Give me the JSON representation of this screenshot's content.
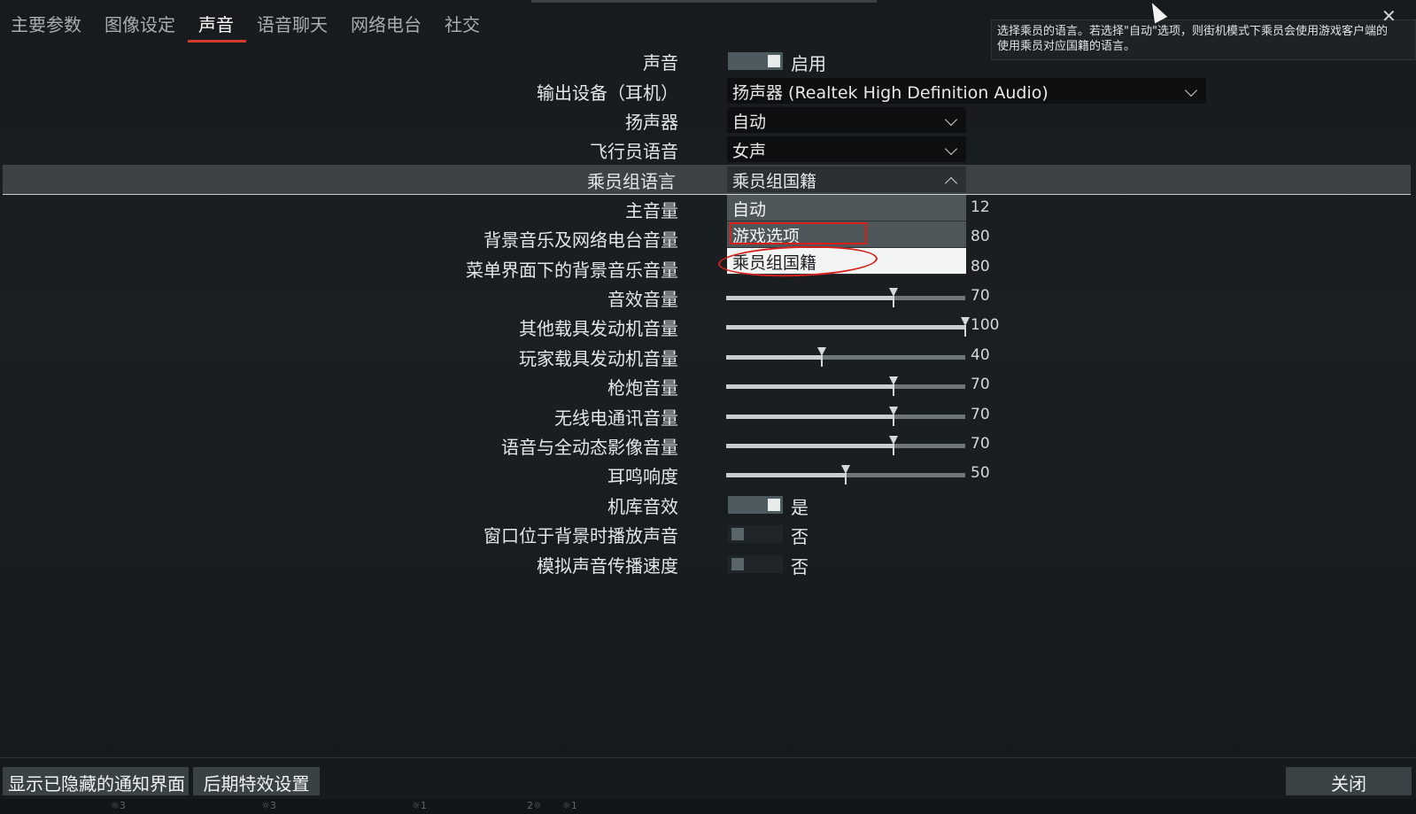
{
  "tabs": [
    {
      "label": "主要参数"
    },
    {
      "label": "图像设定"
    },
    {
      "label": "声音"
    },
    {
      "label": "语音聊天"
    },
    {
      "label": "网络电台"
    },
    {
      "label": "社交"
    }
  ],
  "tooltip": {
    "line1": "选择乘员的语言。若选择\"自动\"选项，则街机模式下乘员会使用游戏客户端的",
    "line2": "使用乘员对应国籍的语言。"
  },
  "close_glyph": "✕",
  "settings": {
    "sound": {
      "label": "声音",
      "value": "启用",
      "on": true
    },
    "output_device": {
      "label": "输出设备（耳机）",
      "value": "扬声器 (Realtek High Definition Audio)"
    },
    "speakers": {
      "label": "扬声器",
      "value": "自动"
    },
    "pilot_voice": {
      "label": "飞行员语音",
      "value": "女声"
    },
    "crew_language": {
      "label": "乘员组语言",
      "value": "乘员组国籍"
    },
    "master_volume": {
      "label": "主音量",
      "value": "12",
      "level": 12
    },
    "music_radio_volume": {
      "label": "背景音乐及网络电台音量",
      "value": "80",
      "level": 80
    },
    "menu_music_volume": {
      "label": "菜单界面下的背景音乐音量",
      "value": "80",
      "level": 80
    },
    "sfx_volume": {
      "label": "音效音量",
      "value": "70",
      "level": 70
    },
    "other_engine_volume": {
      "label": "其他载具发动机音量",
      "value": "100",
      "level": 100
    },
    "player_engine_volume": {
      "label": "玩家载具发动机音量",
      "value": "40",
      "level": 40
    },
    "gun_volume": {
      "label": "枪炮音量",
      "value": "70",
      "level": 70
    },
    "radio_volume": {
      "label": "无线电通讯音量",
      "value": "70",
      "level": 70
    },
    "voice_cinematic_volume": {
      "label": "语音与全动态影像音量",
      "value": "70",
      "level": 70
    },
    "tinnitus": {
      "label": "耳鸣响度",
      "value": "50",
      "level": 50
    },
    "hangar_sfx": {
      "label": "机库音效",
      "value": "是",
      "on": true
    },
    "background_play": {
      "label": "窗口位于背景时播放声音",
      "value": "否",
      "on": false
    },
    "sound_speed": {
      "label": "模拟声音传播速度",
      "value": "否",
      "on": false
    }
  },
  "crew_language_options": [
    {
      "label": "自动"
    },
    {
      "label": "游戏选项"
    },
    {
      "label": "乘员组国籍"
    }
  ],
  "buttons": {
    "show_hidden": "显示已隐藏的通知界面",
    "post_fx": "后期特效设置",
    "close": "关闭"
  },
  "statusbar": [
    "3",
    "3",
    "1",
    "2",
    "1"
  ],
  "colors": {
    "accent": "#d63a2a",
    "annotation": "#d7201a"
  }
}
